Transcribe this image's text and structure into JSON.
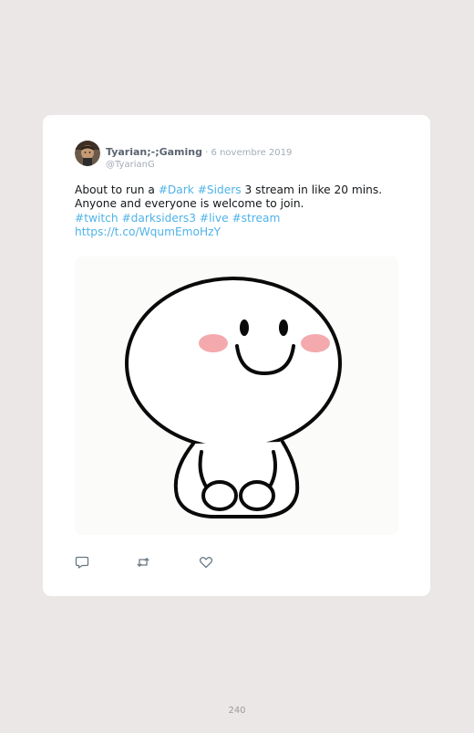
{
  "tweet": {
    "display_name": "Tyarian;-;Gaming",
    "separator": " · ",
    "date": "6 novembre 2019",
    "handle": "@TyarianG",
    "line1_prefix": "About to run a ",
    "line1_tag1": "#Dark",
    "line1_space": " ",
    "line1_tag2": "#Siders",
    "line1_suffix": " 3 stream in like 20 mins.",
    "line2": "Anyone and everyone is welcome to join.",
    "hashtags": [
      "#twitch",
      "#darksiders3",
      "#live",
      "#stream"
    ],
    "link": "https://t.co/WqumEmoHzY",
    "media_alt": "smiling cartoon character sitting",
    "actions": {
      "reply_icon": "reply-icon",
      "retweet_icon": "retweet-icon",
      "like_icon": "heart-icon"
    },
    "colors": {
      "link": "#4fb3e8",
      "name": "#5a6470",
      "meta": "#a3acb5",
      "cheek": "#f4a9ad"
    }
  },
  "page_number": "240"
}
